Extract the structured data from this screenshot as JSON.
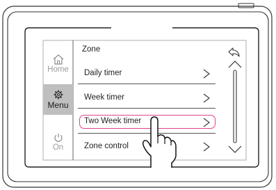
{
  "sidebar": {
    "items": [
      {
        "label": "Home",
        "icon": "home-icon",
        "state": "muted"
      },
      {
        "label": "Menu",
        "icon": "gear-icon",
        "state": "selected"
      },
      {
        "label": "On",
        "icon": "power-icon",
        "state": "muted"
      }
    ]
  },
  "main": {
    "title": "Zone",
    "rows": [
      {
        "label": "Daily timer"
      },
      {
        "label": "Week timer"
      },
      {
        "label": "Two Week timer",
        "highlighted": true
      },
      {
        "label": "Zone control"
      }
    ]
  },
  "scroll": {
    "back_icon": "back-arrow-icon",
    "up_icon": "chevron-up-icon",
    "down_icon": "chevron-down-icon"
  },
  "colors": {
    "highlight": "#e0408f",
    "selected_bg": "#bfbfbf"
  },
  "pointer": {
    "icon": "hand-pointer-icon"
  }
}
